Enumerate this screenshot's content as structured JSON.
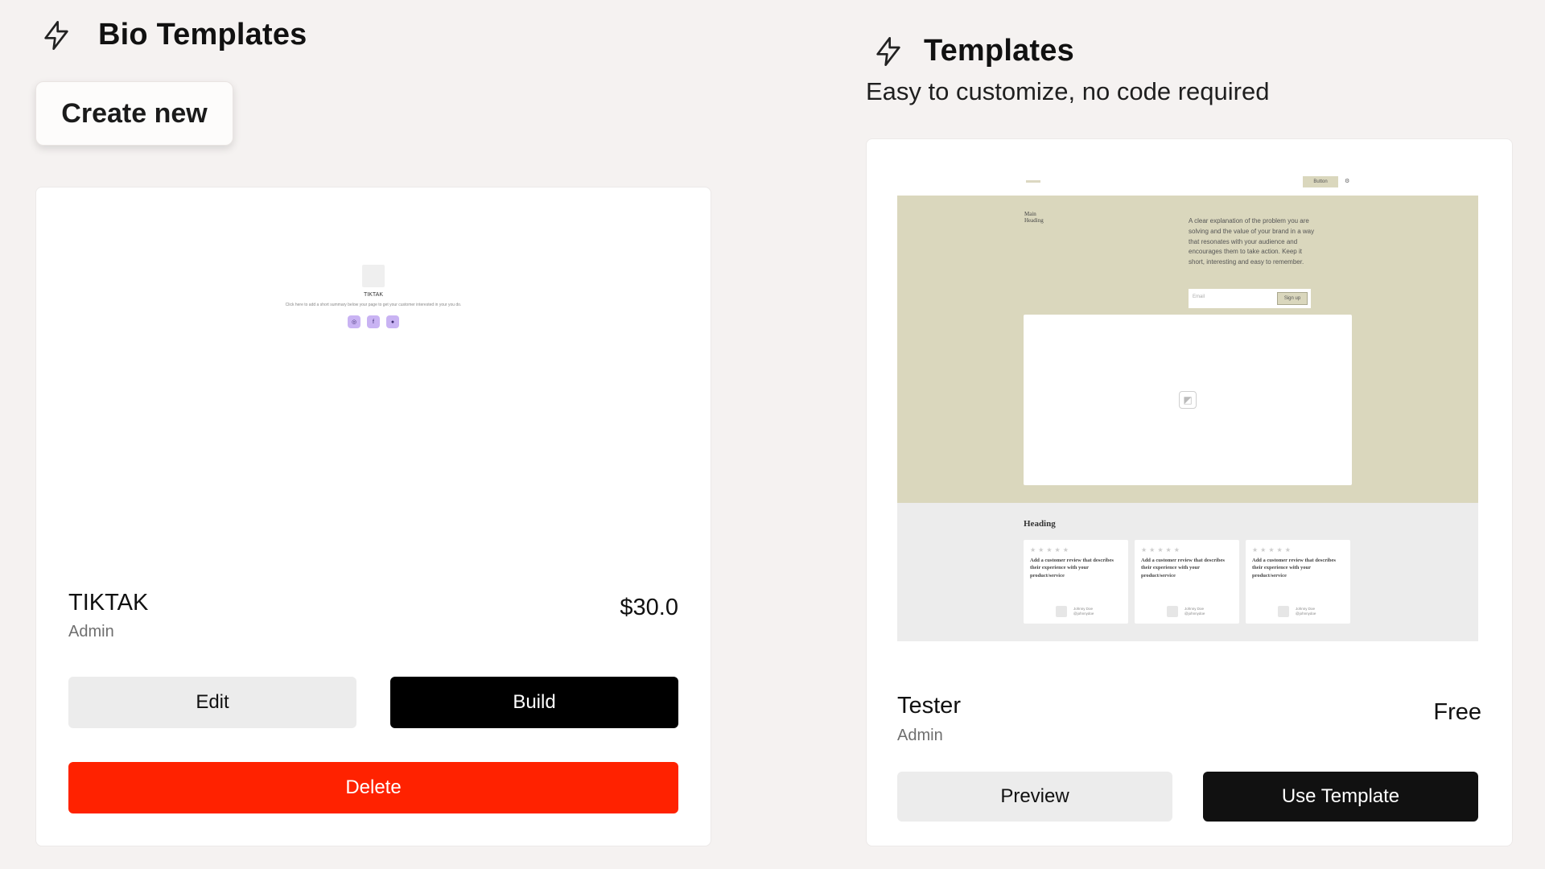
{
  "bio_section": {
    "title": "Bio Templates",
    "create_label": "Create new",
    "card": {
      "preview": {
        "name": "TIKTAK",
        "description": "Click here to add a short summary below your page to get your customer interested in your you do.",
        "socials": [
          "instagram-icon",
          "facebook-icon",
          "globe-icon"
        ]
      },
      "title": "TIKTAK",
      "author": "Admin",
      "price": "$30.0",
      "edit_label": "Edit",
      "build_label": "Build",
      "delete_label": "Delete"
    }
  },
  "templates_section": {
    "title": "Templates",
    "subtitle": "Easy to customize, no code required",
    "card": {
      "preview": {
        "top_button": "Button",
        "hero_heading": "Main Heading",
        "hero_text": "A clear explanation of the problem you are solving and the value of your brand in a way that resonates with your audience and encourages them to take action. Keep it short, interesting and easy to remember.",
        "email_placeholder": "Email",
        "signup_label": "Sign up",
        "reviews_heading": "Heading",
        "reviews": [
          {
            "stars": "★★★★★",
            "text": "Add a customer review that describes their experience with your product/service",
            "author": "Johnny Doe",
            "handle": "@johnnydoe"
          },
          {
            "stars": "★★★★★",
            "text": "Add a customer review that describes their experience with your product/service",
            "author": "Johnny Doe",
            "handle": "@johnnydoe"
          },
          {
            "stars": "★★★★★",
            "text": "Add a customer review that describes their experience with your product/service",
            "author": "Johnny Doe",
            "handle": "@johnnydoe"
          }
        ]
      },
      "title": "Tester",
      "author": "Admin",
      "price": "Free",
      "preview_label": "Preview",
      "use_label": "Use Template"
    }
  },
  "colors": {
    "background": "#f5f2f1",
    "delete": "#ff2200",
    "build": "#000000",
    "hero": "#dad7bd"
  }
}
